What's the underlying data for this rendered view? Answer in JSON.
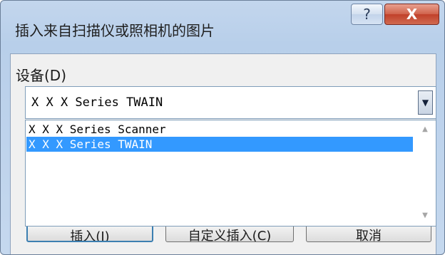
{
  "dialog": {
    "title": "插入来自扫描仪或照相机的图片",
    "help_label": "?",
    "close_label": "X"
  },
  "device": {
    "label": "设备(D)",
    "selected_value": "X X X Series TWAIN",
    "options": [
      {
        "label": "X X X Series Scanner",
        "selected": false
      },
      {
        "label": "X X X Series TWAIN",
        "selected": true
      }
    ]
  },
  "buttons": {
    "insert": "插入(I)",
    "custom_insert": "自定义插入(C)",
    "cancel": "取消"
  }
}
